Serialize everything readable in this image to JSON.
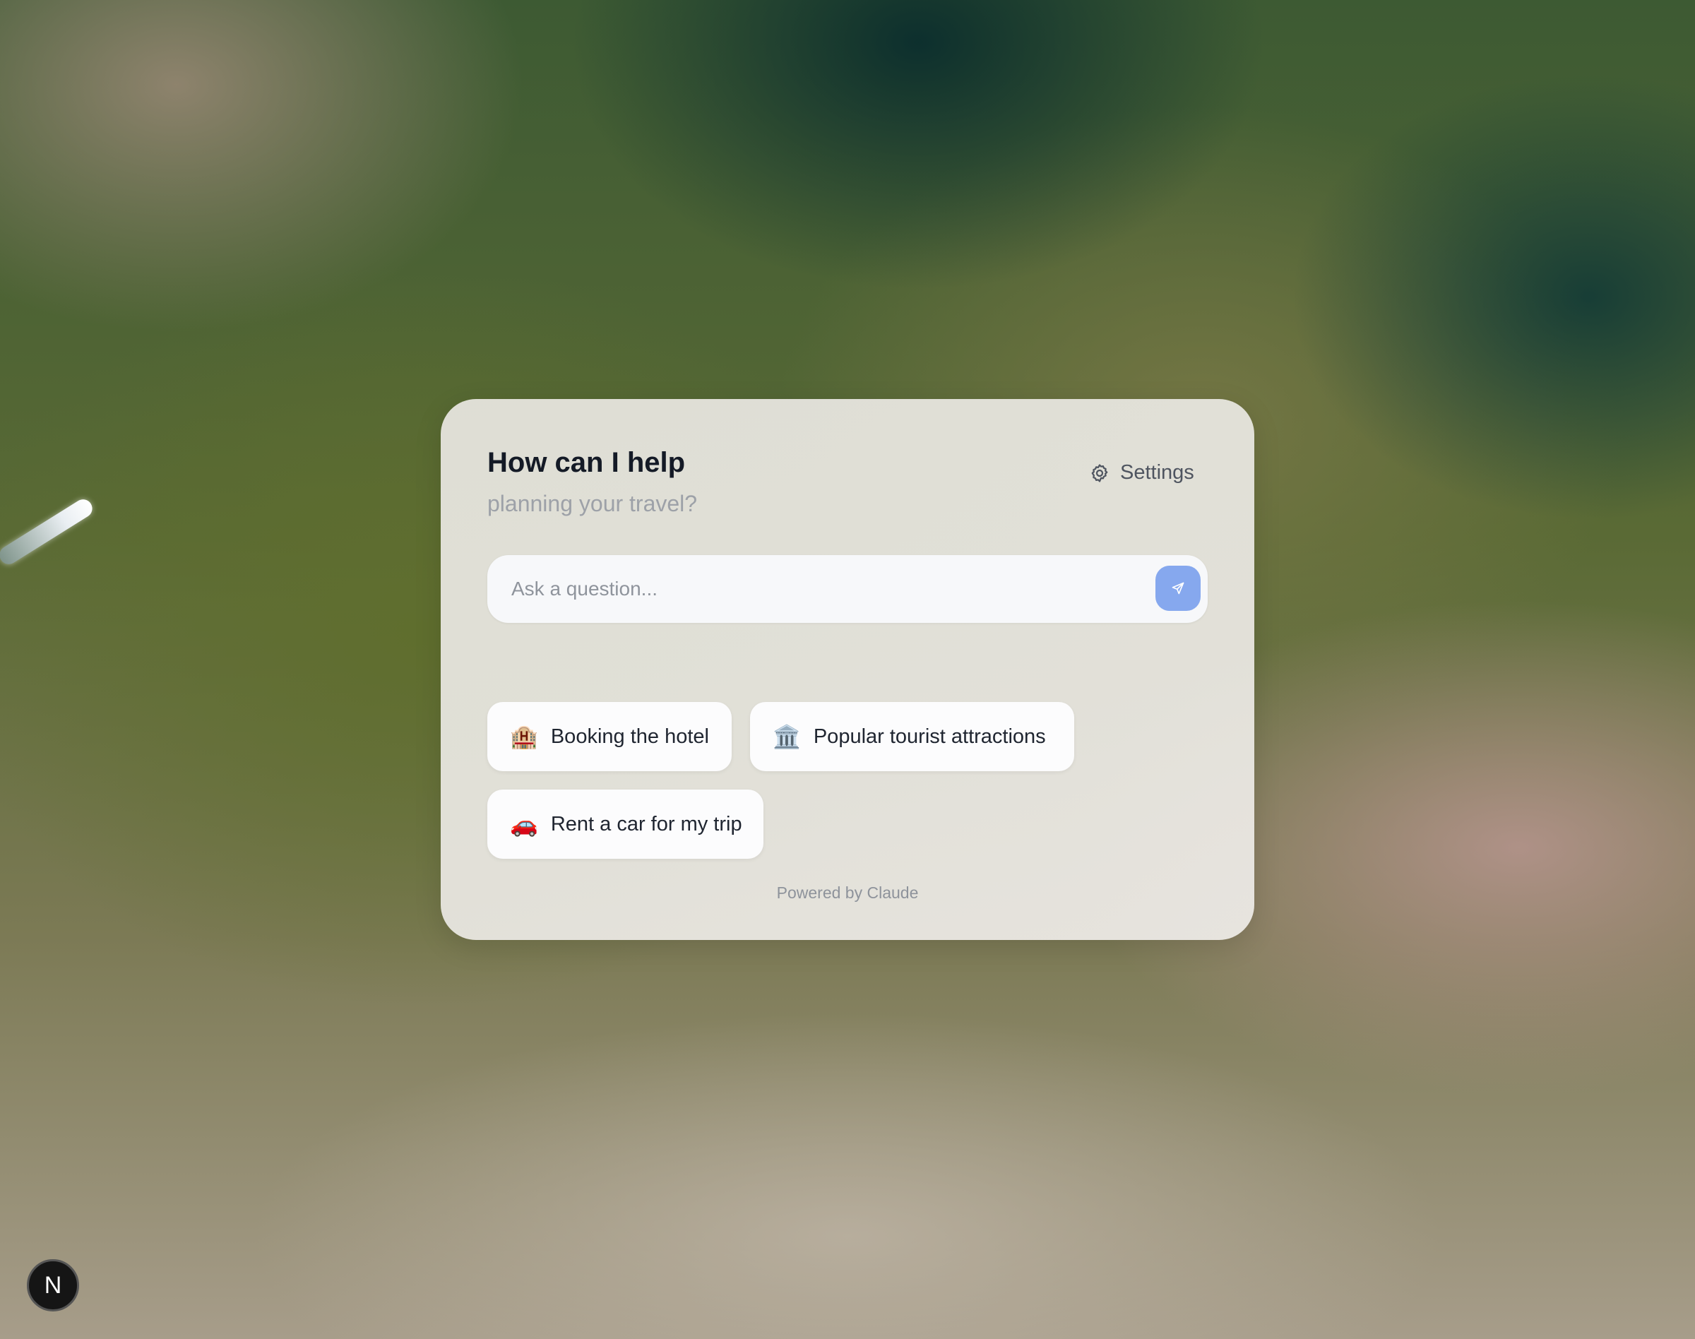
{
  "header": {
    "title": "How can I help",
    "subtitle": "planning your travel?",
    "settings_label": "Settings",
    "settings_icon": "gear-icon"
  },
  "search": {
    "placeholder": "Ask a question...",
    "value": "",
    "send_icon": "send-icon",
    "send_color": "#86a8ee"
  },
  "suggestions": [
    {
      "emoji": "🏨",
      "label": "Booking the hotel"
    },
    {
      "emoji": "🏛️",
      "label": "Popular tourist attractions"
    },
    {
      "emoji": "🚗",
      "label": "Rent a car for my trip"
    }
  ],
  "footer": {
    "powered_by": "Powered by Claude"
  },
  "badge": {
    "letter": "N"
  }
}
